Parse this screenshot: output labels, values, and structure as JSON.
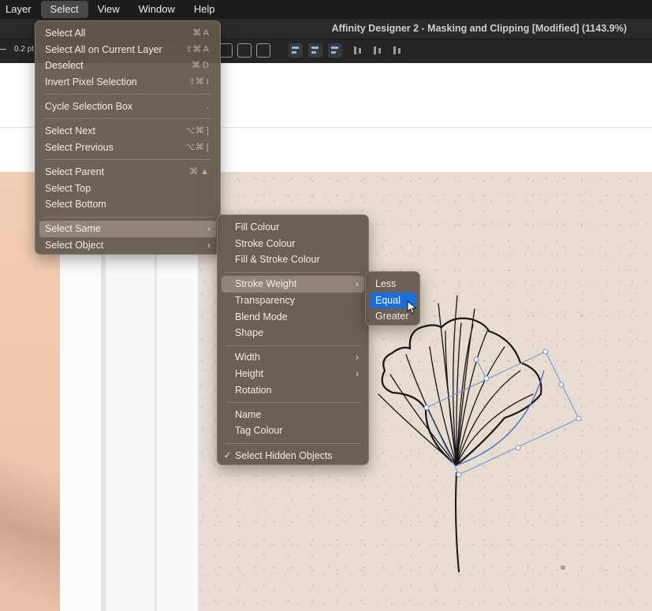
{
  "menubar": {
    "items": [
      "Layer",
      "Select",
      "View",
      "Window",
      "Help"
    ]
  },
  "window": {
    "title": "Affinity Designer 2 - Masking and Clipping [Modified] (1143.9%)"
  },
  "toolbar": {
    "stroke_value": "0.2 pt"
  },
  "select_menu": {
    "items": [
      {
        "label": "Select All",
        "shortcut": "⌘ A"
      },
      {
        "label": "Select All on Current Layer",
        "shortcut": "⇧⌘ A"
      },
      {
        "label": "Deselect",
        "shortcut": "⌘ D"
      },
      {
        "label": "Invert Pixel Selection",
        "shortcut": "⇧⌘ I"
      },
      {
        "label": "Cycle Selection Box",
        "shortcut": "."
      },
      {
        "label": "Select Next",
        "shortcut": "⌥⌘ ]"
      },
      {
        "label": "Select Previous",
        "shortcut": "⌥⌘ ["
      },
      {
        "label": "Select Parent",
        "shortcut": "⌘ ▲"
      },
      {
        "label": "Select Top",
        "shortcut": ""
      },
      {
        "label": "Select Bottom",
        "shortcut": ""
      },
      {
        "label": "Select Same",
        "shortcut": ""
      },
      {
        "label": "Select Object",
        "shortcut": ""
      }
    ]
  },
  "select_same_menu": {
    "items": [
      {
        "label": "Fill Colour"
      },
      {
        "label": "Stroke Colour"
      },
      {
        "label": "Fill & Stroke Colour"
      },
      {
        "label": "Stroke Weight"
      },
      {
        "label": "Transparency"
      },
      {
        "label": "Blend Mode"
      },
      {
        "label": "Shape"
      },
      {
        "label": "Width"
      },
      {
        "label": "Height"
      },
      {
        "label": "Rotation"
      },
      {
        "label": "Name"
      },
      {
        "label": "Tag Colour"
      },
      {
        "label": "Select Hidden Objects",
        "checked": true
      }
    ]
  },
  "stroke_weight_menu": {
    "items": [
      {
        "label": "Less"
      },
      {
        "label": "Equal",
        "selected": true
      },
      {
        "label": "Greater"
      }
    ]
  },
  "colors": {
    "menu_bg": "#63584e",
    "selected_item": "#1a6fde",
    "menubar_bg": "#1e1d1d",
    "selection_outline": "#6e9bd6"
  }
}
